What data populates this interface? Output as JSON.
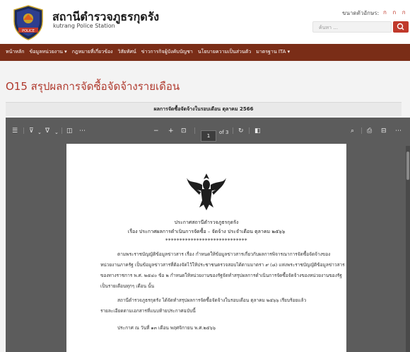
{
  "header": {
    "title": "สถานีตำรวจภูธรกุดรัง",
    "subtitle": "kutrang Police Station",
    "font_size_label": "ขนาดตัวอักษร:",
    "font_size_options": "ก ก ก",
    "search_placeholder": "ค้นหา ...",
    "logo_text": "POLICE"
  },
  "nav": {
    "items": [
      "หน้าหลัก",
      "ข้อมูลหน่วยงาน ▾",
      "กฎหมายที่เกี่ยวข้อง",
      "วิสัยทัศน์",
      "ข่าวการกิจผู้บังคับบัญชา",
      "นโยบายความเป็นส่วนตัว",
      "มาตรฐาน ITA ▾"
    ]
  },
  "main": {
    "page_title": "O15 สรุปผลการจัดซื้อจัดจ้างรายเดือน",
    "caption": "ผลการจัดซื้อจัดจ้างในรอบเดือน ตุลาคม 2566"
  },
  "pdf_toolbar": {
    "page_current": "1",
    "page_total": "of 3"
  },
  "document": {
    "heading1": "ประกาศสถานีตำรวจภูธรกุดรัง",
    "heading2": "เรื่อง ประกาศผลการดำเนินการจัดซื้อ – จัดจ้าง ประจำเดือน ตุลาคม ๒๕๖๖",
    "stars": "*****************************",
    "paragraphs": [
      "ตามพระราชบัญญัติข้อมูลข่าวสาร เรื่อง กำหนดให้ข้อมูลข่าวสารเกี่ยวกับผลการพิจารณาการจัดซื้อจัดจ้างของ",
      "หน่วยงานภาครัฐ เป็นข้อมูลข่าวสารที่ต้องจัดไว้ให้ประชาชนตรวจสอบได้ตามมาตรา ๙ (๘)  แห่งพระราชบัญญัติข้อมูลข่าวสาร",
      "ของทางราชการ พ.ศ. ๒๕๔๐ ข้อ ๒ กำหนดให้หน่วยงานของรัฐจัดทำสรุปผลการดำเนินการจัดซื้อจัดจ้างของหน่วยงานของรัฐ",
      "เป็นรายเดือนทุกๆ เดือน นั้น",
      "สถานีตำรวจภูธรกุดรัง ได้จัดทำสรุปผลการจัดซื้อจัดจ้างในรอบเดือน ตุลาคม ๒๕๖๖ เรียบร้อยแล้ว",
      "รายละเอียดตามเอกสารที่แนบท้ายประกาศฉบับนี้",
      "ประกาศ ณ วันที่ ๑๓ เดือน พฤศจิกายน พ.ศ.๒๕๖๖"
    ]
  },
  "colors": {
    "nav_bg": "#7a2d17",
    "accent": "#c0392b",
    "title": "#b03a2e",
    "viewer_bg": "#5c5c5c"
  }
}
